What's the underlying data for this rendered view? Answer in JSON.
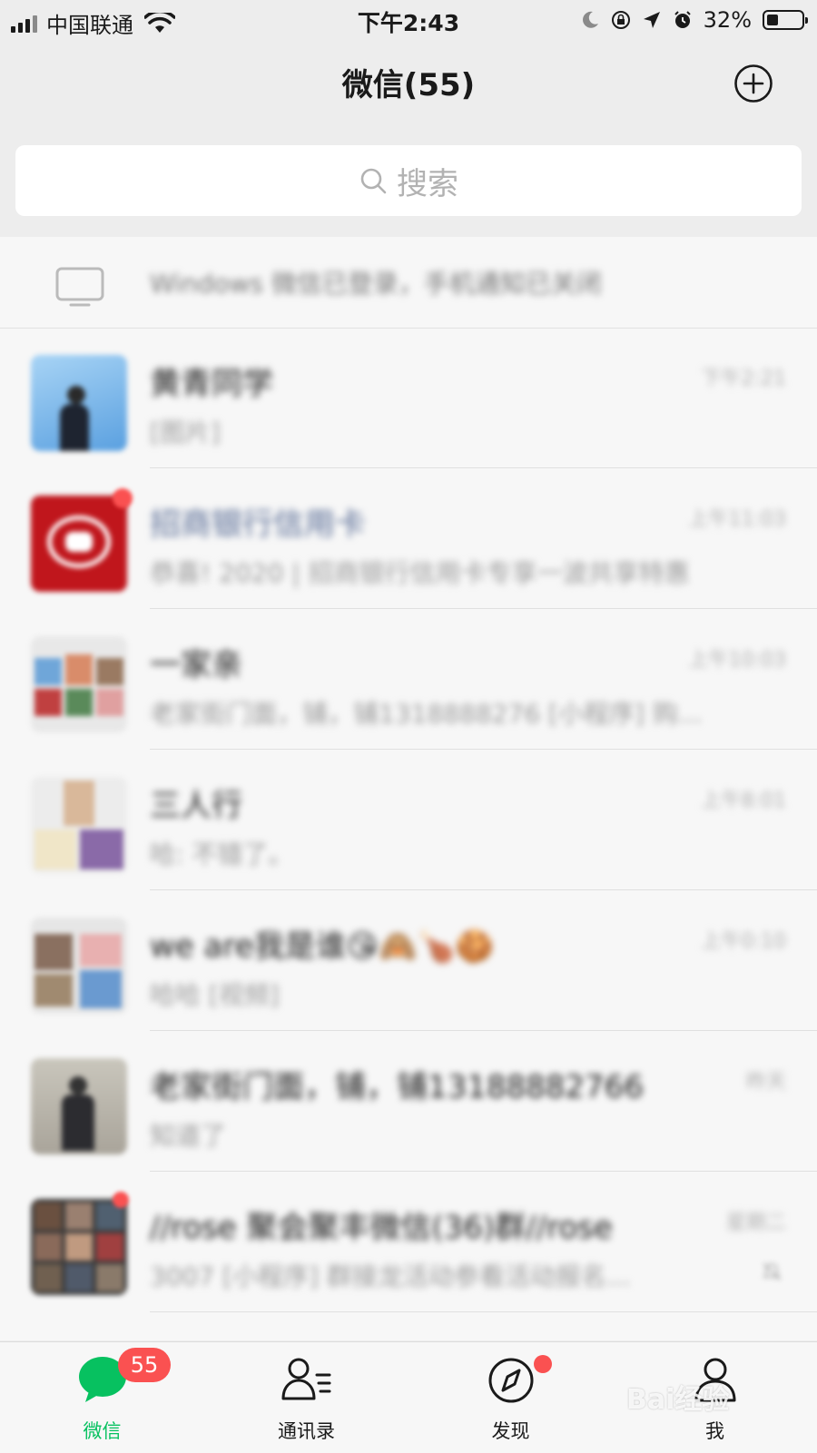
{
  "status_bar": {
    "carrier": "中国联通",
    "time": "下午2:43",
    "battery_percent": "32%",
    "battery_level": 0.32
  },
  "nav": {
    "title": "微信(55)",
    "add_icon": "plus-circle-icon"
  },
  "search": {
    "placeholder": "搜索"
  },
  "notice": {
    "text": "Windows 微信已登录，手机通知已关闭"
  },
  "chats": [
    {
      "name": "黄青同学",
      "message": "[图片]",
      "time": "下午2:21",
      "unread_dot": false,
      "muted": false
    },
    {
      "name": "招商银行信用卡",
      "message": "恭喜! 2020 | 招商银行信用卡专享一波共享特惠",
      "time": "上午11:03",
      "unread_dot": true,
      "muted": false
    },
    {
      "name": "一家亲",
      "message": "老家街门面，铺，铺1318888276 [小程序] 购...",
      "time": "上午10:03",
      "unread_dot": false,
      "muted": false
    },
    {
      "name": "三人行",
      "message": "哈: 不错了。",
      "time": "上午8:01",
      "unread_dot": false,
      "muted": false
    },
    {
      "name": "we are我是谁😘🙈🍗🍪",
      "message": "哈哈 [视频]",
      "time": "上午0:10",
      "unread_dot": false,
      "muted": false
    },
    {
      "name": "老家街门面，铺，铺13188882766",
      "message": "知道了",
      "time": "昨天",
      "unread_dot": false,
      "muted": false
    },
    {
      "name": "//rose 聚会聚丰微信(36)群//rose",
      "message": "3007 [小程序] 群接龙活动参看活动报名...",
      "time": "星期二",
      "unread_dot": true,
      "muted": true
    }
  ],
  "tabbar": {
    "tabs": [
      {
        "label": "微信",
        "icon": "chat-bubble-icon",
        "active": true,
        "badge": "55"
      },
      {
        "label": "通讯录",
        "icon": "contacts-icon",
        "active": false
      },
      {
        "label": "发现",
        "icon": "compass-icon",
        "active": false,
        "dot": true
      },
      {
        "label": "我",
        "icon": "person-icon",
        "active": false
      }
    ]
  },
  "watermark": "Bai经验",
  "colors": {
    "accent": "#07c160",
    "badge": "#fa5151",
    "background": "#ededed"
  }
}
